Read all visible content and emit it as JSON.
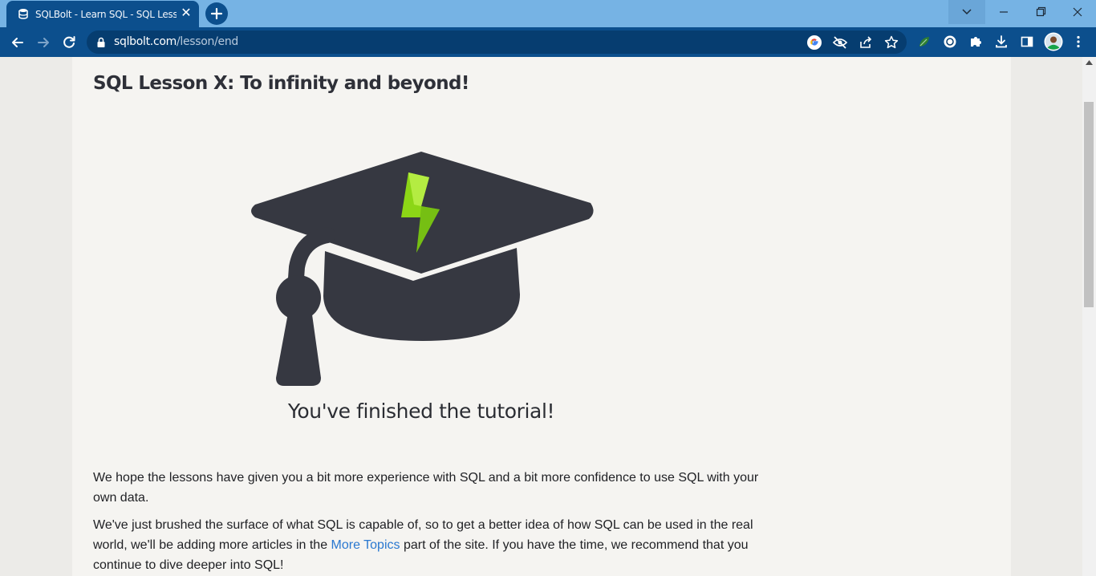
{
  "browser": {
    "tab_title": "SQLBolt - Learn SQL - SQL Lesson X: To infinity and beyond!",
    "tab_close": "✕",
    "url_host": "sqlbolt.com",
    "url_path": "/lesson/end"
  },
  "icons": {
    "tab_favicon": "database-icon",
    "new_tab": "plus-icon",
    "back": "arrow-left-icon",
    "forward": "arrow-right-icon",
    "reload": "reload-icon",
    "lock": "lock-icon",
    "google": "google-icon",
    "eye_off": "eye-off-icon",
    "share": "share-icon",
    "bookmark": "star-icon",
    "extension_1": "leaf-icon",
    "extension_2": "circle-icon",
    "extensions": "puzzle-icon",
    "download": "download-icon",
    "side_panel": "side-panel-icon",
    "profile": "avatar",
    "menu": "more-vertical-icon",
    "tab_search": "chevron-down-icon",
    "minimize": "minimize-icon",
    "restore": "restore-icon",
    "close_window": "close-icon"
  },
  "colors": {
    "tab_strip": "#76b3e4",
    "toolbar": "#0c4f8d",
    "page_background": "#f5f4f1",
    "cap": "#363841",
    "bolt": "#90d71a",
    "link": "#2a78d0"
  },
  "content": {
    "lesson_title": "SQL Lesson X: To infinity and beyond!",
    "finished_caption": "You've finished the tutorial!",
    "para1": "We hope the lessons have given you a bit more experience with SQL and a bit more confidence to use SQL with your own data.",
    "para2_before": "We've just brushed the surface of what SQL is capable of, so to get a better idea of how SQL can be used in the real world, we'll be adding more articles in the ",
    "para2_link": "More Topics",
    "para2_after": " part of the site. If you have the time, we recommend that you continue to dive deeper into SQL!"
  }
}
